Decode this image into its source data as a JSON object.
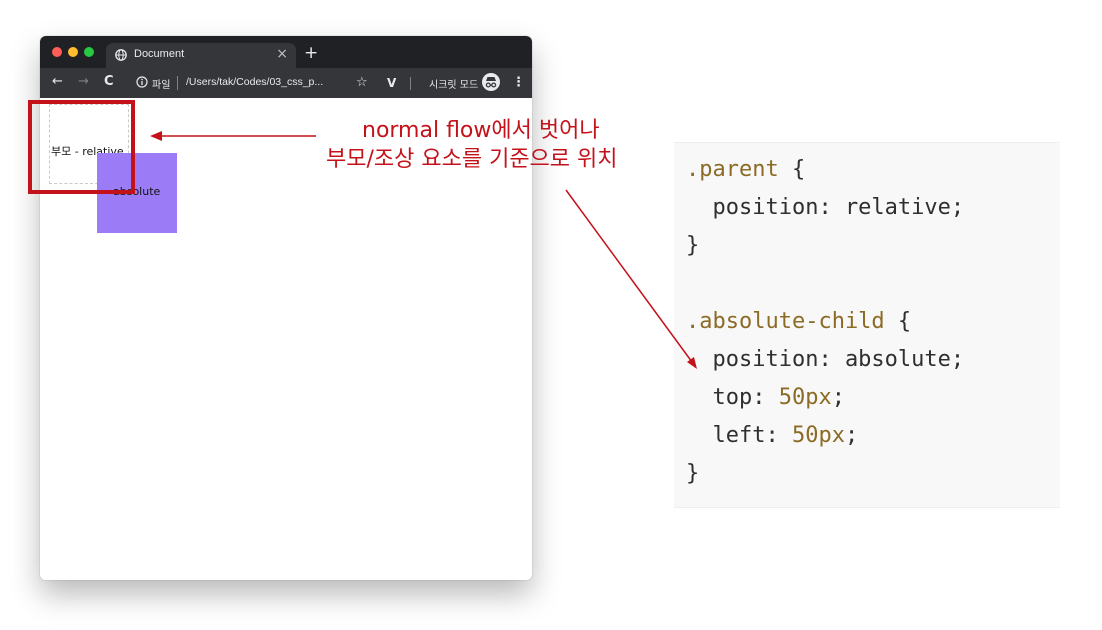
{
  "browser": {
    "tab_title": "Document",
    "tab_close": "×",
    "new_tab": "+",
    "nav": {
      "back": "←",
      "forward": "→",
      "reload": "C"
    },
    "omnibox": {
      "scheme_label": "파일",
      "url": "/Users/tak/Codes/03_css_p..."
    },
    "star": "☆",
    "extension": "V",
    "incognito_label": "시크릿 모드",
    "menu": "⋮",
    "icons": {
      "tab": "globe-icon",
      "info": "info-icon",
      "star": "star-icon",
      "extension": "vue-devtools-icon",
      "avatar": "incognito-icon",
      "menu": "kebab-menu-icon"
    }
  },
  "page": {
    "parent_text": "부모 - relative",
    "absolute_text": "absolute",
    "colors": {
      "absolute_box": "#9b7cf6",
      "highlight": "#c4121a"
    }
  },
  "annotation": {
    "line1": "normal flow에서 벗어나",
    "line2": "부모/조상 요소를 기준으로 위치",
    "color": "#c4121a"
  },
  "code": {
    "l1_selector": ".parent",
    "l1_brace": " {",
    "l2": "  position: relative;",
    "l3": "}",
    "l5_selector": ".absolute-child",
    "l5_brace": " {",
    "l6": "  position: absolute;",
    "l7_prop": "  top: ",
    "l7_val": "50px",
    "l7_end": ";",
    "l8_prop": "  left: ",
    "l8_val": "50px",
    "l8_end": ";",
    "l9": "}",
    "colors": {
      "selector": "#8b6b26",
      "number": "#8b6b26",
      "text": "#2f2f2f"
    }
  }
}
